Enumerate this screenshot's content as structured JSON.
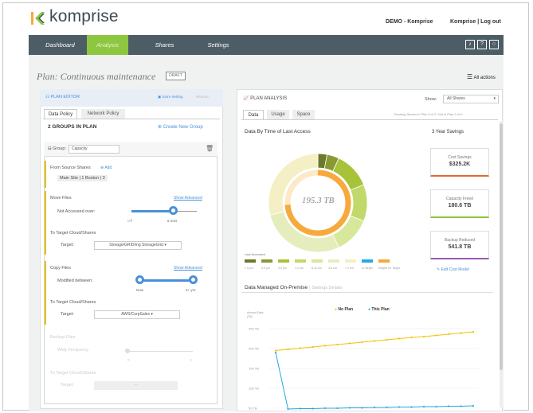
{
  "header": {
    "brand": "komprise",
    "account_label": "DEMO - Komprise",
    "user_links": "Komprise | Log out"
  },
  "nav": {
    "items": [
      {
        "label": "Dashboard",
        "active": false
      },
      {
        "label": "Analysis",
        "active": true
      },
      {
        "label": "Shares",
        "active": false
      },
      {
        "label": "Settings",
        "active": false
      }
    ],
    "icons": [
      "bell-icon",
      "help-icon",
      "chat-icon"
    ]
  },
  "plan": {
    "title": "Plan: Continuous maintenance",
    "badge": "DRAFT",
    "all_actions": "All actions"
  },
  "editor": {
    "title": "PLAN EDITOR",
    "store_setting": "Store Setting",
    "restore": "Restore",
    "tabs": [
      "Data Policy",
      "Network Policy"
    ],
    "groups_count": "2 GROUPS IN PLAN",
    "create_group": "Create New Group",
    "group_label": "Group:",
    "group_name": "Capacity",
    "from_shares_label": "From Source Shares",
    "add_label": "Add",
    "shares_value": "Main Site | 1   Boston | 3",
    "move_files": "Move Files",
    "show_advanced_1": "Show Advanced",
    "not_accessed": "Not Accessed over:",
    "move_slider_min": "Off",
    "move_slider_val": "6 mos",
    "to_target_1": "To Target Cloud/Shares",
    "target_label_1": "Target:",
    "target_value_1": "Storage/GRID/ing StorageGrid",
    "copy_files": "Copy Files",
    "show_advanced_2": "Show Advanced",
    "modified_between": "Modified between:",
    "copy_slider_min": "Now",
    "copy_slider_max": "2+ yrs",
    "to_target_2": "To Target Cloud/Shares",
    "target_label_2": "Target:",
    "target_value_2": "AWS/CorpSales",
    "backup_files": "Backup Files",
    "backup_freq": "Wkly Frequency",
    "backup_min": "0",
    "backup_max": "0",
    "to_target_3": "To Target Cloud/Shares",
    "target_label_3": "Target:",
    "target_value_3": "---"
  },
  "analysis": {
    "title": "PLAN ANALYSIS",
    "show_label": "Show:",
    "show_value": "All Shares",
    "tabs": [
      "Data",
      "Usage",
      "Space"
    ],
    "showing_note": "Showing Shares in Plan 5 of 5. Not in Plan 0 of 0",
    "chart_title": "Data By Time of Last Access",
    "donut_value": "195.3 TB",
    "legend_caption": "Last Accessed",
    "legend_labels": [
      "> 5 yrs",
      "3-5 yrs",
      "2-3 yrs",
      "1-2 yrs",
      "6-12 mo",
      "3-6 mo",
      "< 3 mo",
      "In Target",
      "Eligible for Target"
    ],
    "savings_title": "3 Year Savings",
    "savings": [
      {
        "label": "Cost Savings",
        "value": "$325.2K",
        "accent": "#e36b2b"
      },
      {
        "label": "Capacity Freed",
        "value": "180.6 TB",
        "accent": "#8dc63f"
      },
      {
        "label": "Backup Reduced",
        "value": "541.8 TB",
        "accent": "#9b59b6"
      }
    ],
    "edit_cost": "Edit Cost Model",
    "managed_title": "Data Managed On-Premise",
    "managed_sub": "Savings Details",
    "legend_no_plan": "No Plan",
    "legend_this_plan": "This Plan",
    "y_caption": "Amount Data (TB)"
  },
  "chart_data": {
    "type": "line",
    "title": "Data Managed On-Premise",
    "ylabel": "Amount Data (TB)",
    "y_ticks": [
      "250 TB",
      "200 TB",
      "150 TB",
      "100 TB",
      "50 TB"
    ],
    "ylim": [
      50,
      250
    ],
    "series": [
      {
        "name": "No Plan",
        "color": "#f2c200",
        "values": [
          195,
          198,
          201,
          204,
          207,
          210,
          213,
          216,
          219,
          222,
          225,
          228,
          230,
          233,
          236,
          239,
          242
        ]
      },
      {
        "name": "This Plan",
        "color": "#29a9e0",
        "values": [
          190,
          48,
          49,
          49,
          50,
          50,
          51,
          51,
          52,
          52,
          53,
          53,
          54,
          54,
          55,
          55,
          56
        ]
      }
    ]
  },
  "donut_data": {
    "segments": [
      {
        "label": "> 5 yrs",
        "value": 3,
        "color": "#6b7a2b"
      },
      {
        "label": "3-5 yrs",
        "value": 4,
        "color": "#8a9a33"
      },
      {
        "label": "2-3 yrs",
        "value": 12,
        "color": "#a6c33a"
      },
      {
        "label": "1-2 yrs",
        "value": 12,
        "color": "#c0d96a"
      },
      {
        "label": "6-12 mo",
        "value": 12,
        "color": "#d7e89a"
      },
      {
        "label": "3-6 mo",
        "value": 28,
        "color": "#e6edbd"
      },
      {
        "label": "< 3 mo",
        "value": 29,
        "color": "#f5efc5"
      }
    ],
    "inner_progress": 0.74,
    "inner_color": "#f7a93b"
  }
}
